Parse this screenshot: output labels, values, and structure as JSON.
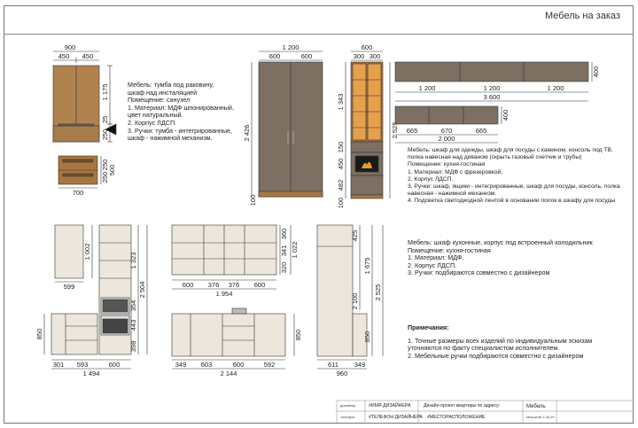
{
  "sheet_title": "Мебель на заказ",
  "bath": {
    "dims": {
      "top_total": "900",
      "top_left": "450",
      "top_right": "450",
      "h1": "1 175",
      "h2": "25",
      "h3": "250",
      "h4": "250",
      "h5": "250",
      "h6": "500",
      "bottom": "700"
    },
    "notes": [
      "Мебель: тумба под раковину,",
      "шкаф над инсталяцией",
      "Помещение: санузел",
      "",
      "1. Материал: МДФ шпонированный,",
      "цвет натуральный.",
      "2. Корпус ЛДСП.",
      "3. Ручки: тумба - интегрированные,",
      "шкаф - нажимной механизм."
    ]
  },
  "living": {
    "dims": {
      "wardrobe_total": "1 200",
      "wardrobe_left": "600",
      "wardrobe_right": "600",
      "wardrobe_h": "2 426",
      "wardrobe_base": "100",
      "glass_top": "600",
      "glass_l": "300",
      "glass_r": "300",
      "col_h1": "1 343",
      "col_h2": "150",
      "col_h3": "450",
      "col_h4": "482",
      "col_h5": "100",
      "col_total": "2 525",
      "wall_1": "1 200",
      "wall_2": "1 200",
      "wall_3": "1 200",
      "wall_total": "3 600",
      "wall_h": "400",
      "shelf_1": "665",
      "shelf_2": "670",
      "shelf_3": "665",
      "shelf_total": "2 000",
      "shelf_h": "400"
    },
    "notes": [
      "Мебель: шкаф для одежды, шкаф для посуды с камином, консоль под ТВ,",
      "полка навесная над диваном (скрыть газовый счетчик и трубы)",
      "Помещение: кухня-гостиная",
      "1. Материал: МДФ с фрезеровкой,",
      "2. Корпус ЛДСП.",
      "3. Ручки: шкаф, ящики - интегрированные, шкаф для посуды, консоль, полка",
      "навесная - нажимной механизм.",
      "4. Подсветка светодиодной лентой в основании полок в шкафу для посуды"
    ]
  },
  "kitchen": {
    "dims": {
      "upper_w": "599",
      "upper_h": "1 002",
      "tall_h1": "1 323",
      "tall_h2": "354",
      "tall_h3": "443",
      "tall_h4": "398",
      "tall_total": "2 504",
      "base_h": "850",
      "base_1": "301",
      "base_2": "593",
      "base_3": "600",
      "base_total": "1 494",
      "mid_up_1": "600",
      "mid_up_2": "376",
      "mid_up_3": "376",
      "mid_up_4": "600",
      "mid_up_total": "1 954",
      "mid_h1": "360",
      "mid_h2": "341",
      "mid_h3": "320",
      "mid_h_total": "1 022",
      "mid_base_1": "349",
      "mid_base_2": "603",
      "mid_base_3": "600",
      "mid_base_4": "592",
      "mid_base_total": "2 144",
      "mid_base_h": "850",
      "fridge_top": "425",
      "fridge_h1": "1 675",
      "fridge_h2": "2 100",
      "fridge_total": "2 525",
      "fridge_base_h": "850",
      "fridge_w1": "611",
      "fridge_w2": "349",
      "fridge_total_w": "960"
    },
    "notes": [
      "Мебель: шкаф кухонные, корпус под встроенный холодильник",
      "Помещение: кухня-гостиная",
      "",
      "1. Материал: МДФ.",
      "2. Корпус ЛДСП.",
      "3. Ручки: подбираются совместно с дизайнером"
    ]
  },
  "remarks": {
    "heading": "Примечания:",
    "items": [
      "1. Точные размеры всех изделий по индивидуальным эскизам",
      "уточняются по факту специалистом исполнителем.",
      "2. Мебельные ручки подбираются совместно с дизайнером"
    ]
  },
  "title_block": {
    "designer_label": "дизайнер",
    "designer_value": "#ИМЯ ДИЗАЙНЕРА",
    "phone_label": "телефон",
    "phone_value": "#ТЕЛЕФОН ДИЗАЙНЕРА",
    "project_label": "Дизайн-проект квартиры по адресу:",
    "location_value": "#МЕСТОРАСПОЛОЖЕНИЕ",
    "sheet_name": "Мебель",
    "scale": "Масштаб 1:28,29"
  },
  "colors": {
    "wood": "#a8773f",
    "wood_dark": "#7a5a3a",
    "gray_wood": "#7d6f62",
    "cream": "#ece6dc",
    "line": "#333333"
  }
}
